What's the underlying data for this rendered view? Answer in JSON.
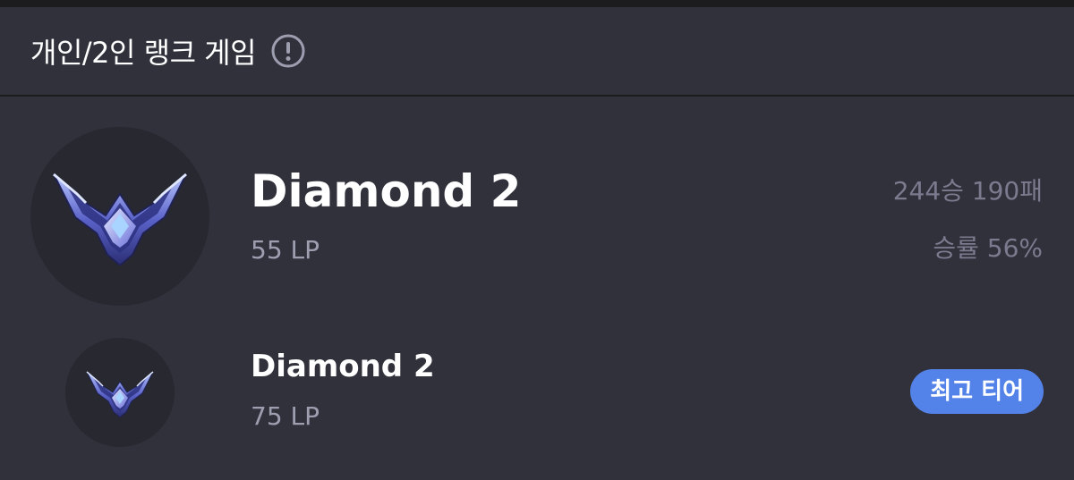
{
  "header": {
    "title": "개인/2인 랭크 게임",
    "info_icon": "info-icon"
  },
  "current_rank": {
    "tier": "Diamond 2",
    "lp": "55 LP",
    "record": "244승 190패",
    "win_rate": "승률 56%",
    "emblem_icon": "diamond-emblem-icon"
  },
  "peak_rank": {
    "tier": "Diamond 2",
    "lp": "75 LP",
    "badge": "최고 티어",
    "emblem_icon": "diamond-emblem-icon"
  },
  "colors": {
    "background": "#31313c",
    "emblem_bg": "#282830",
    "badge": "#5383e8",
    "muted_text": "#9e9eb1"
  }
}
